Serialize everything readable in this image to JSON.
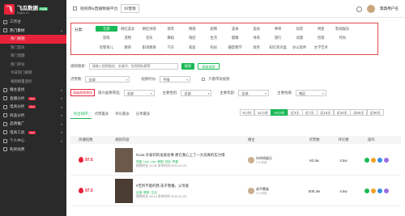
{
  "logo": {
    "mark": "飞",
    "name": "飞瓜数据",
    "tag": "抖音版",
    "sub": "feigua.cn"
  },
  "sidebar": {
    "items": [
      {
        "label": "工作台",
        "icon": "dashboard-icon"
      },
      {
        "label": "热门素材",
        "icon": "fire-icon",
        "expanded": true
      }
    ],
    "sub": [
      {
        "label": "热门视频",
        "active": true
      },
      {
        "label": "热门音乐"
      },
      {
        "label": "热门话题"
      },
      {
        "label": "热门评论"
      },
      {
        "label": "今日热门视频"
      },
      {
        "label": "视频刷量监控"
      }
    ],
    "bottom": [
      {
        "label": "播主查找",
        "icon": "user-search-icon"
      },
      {
        "label": "直播分析",
        "icon": "live-icon",
        "badge": "New"
      },
      {
        "label": "电商分析",
        "icon": "cart-icon",
        "badge": "New"
      },
      {
        "label": "商品分析",
        "icon": "goods-icon"
      },
      {
        "label": "品牌推广",
        "icon": "brand-icon"
      },
      {
        "label": "电商工具",
        "icon": "tool-icon",
        "badge": "New"
      },
      {
        "label": "个人中心",
        "icon": "person-icon"
      },
      {
        "label": "购买续费",
        "icon": "wallet-icon"
      }
    ]
  },
  "topbar": {
    "crumb": "短视频&直播数据平台",
    "platform": "抖音版",
    "user": "飘飘用户名"
  },
  "category": {
    "label": "分类:",
    "items": [
      "全部",
      "网红美女",
      "网红帅哥",
      "搞笑",
      "情感",
      "剧情",
      "美食",
      "美妆",
      "种草",
      "穿搭",
      "明星",
      "影视娱乐",
      "游戏",
      "宠物",
      "音乐",
      "舞蹈",
      "萌娃",
      "生活",
      "健康",
      "体育",
      "旅行",
      "动漫",
      "创意",
      "时尚",
      "母婴育儿",
      "教育",
      "职场教育",
      "汽车",
      "家居",
      "科技",
      "摄影教学",
      "政务",
      "知识资讯类",
      "办公软件",
      "文学艺术",
      ""
    ]
  },
  "filters": {
    "search_label": "视频搜索:",
    "search_placeholder": "请输入视频描述、关键词、短视频标题等",
    "search_btn": "搜索",
    "advanced_btn": "高级搜索",
    "likes_label": "点赞数:",
    "likes_value": "全部",
    "duration_label": "视频时长:",
    "duration_value": "不限",
    "shop_only": "只看带货视频",
    "promo_label": "高级视频筛选",
    "promo_mode_label": "观众画像筛选:",
    "promo_mode": "全部",
    "gender_label": "主要性别:",
    "gender": "全部",
    "age_label": "主要年龄:",
    "age": "全部",
    "region_label": "主要地域:",
    "region": "地区"
  },
  "tabs": [
    "综合排序",
    "点赞最多",
    "评论最多",
    "分享最多"
  ],
  "time_tabs": [
    "6小时",
    "12小时",
    "24小时",
    "近3天",
    "近7天",
    "近15天",
    "近30天",
    "近60天",
    "近90天"
  ],
  "table": {
    "headers": [
      "热播指数",
      "视频内容",
      "播主",
      "点赞数",
      "评论数",
      "操作"
    ],
    "rows": [
      {
        "score": "97.6",
        "title": "#Lisa 许家印的发家往事 想在我心上了一大前真的实力哦",
        "tags": [
          "明星",
          "Lisa",
          "Lisa",
          "韩国",
          "时尚",
          "青春"
        ],
        "time": "视频时长 00:30 发布时间 2019-11-23",
        "author": "叼鸡鸡娱乐",
        "author_sub": "0 小时前",
        "likes": "60.3w",
        "comments": "4.5w"
      },
      {
        "score": "97.5",
        "title": "#无所不能的我 孩子我懂，父母爱",
        "tags": [
          "百度",
          "情感",
          "生活"
        ],
        "time": "视频时长 00:14 发布时间 2019-11-23",
        "author": "叔不晚娱",
        "author_sub": "0 小时前",
        "likes": "505.3w",
        "comments": "4.6w"
      }
    ]
  },
  "colors": {
    "accent": "#19b955",
    "brand": "#e9223b",
    "sidebar": "#2a2a2a"
  }
}
